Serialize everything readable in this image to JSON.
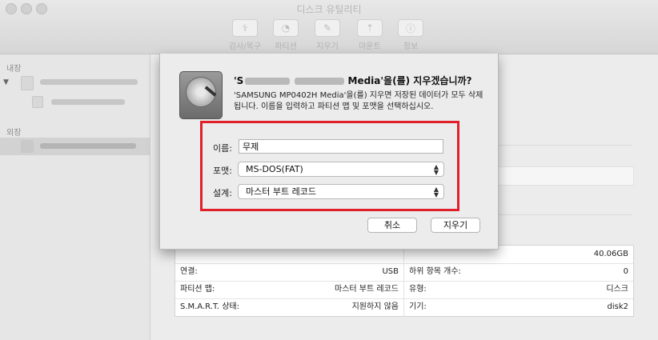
{
  "window": {
    "title": "디스크 유틸리티"
  },
  "toolbar": {
    "items": [
      {
        "label": "검사/복구",
        "icon": "stethoscope-icon"
      },
      {
        "label": "파티션",
        "icon": "pie-chart-icon"
      },
      {
        "label": "지우기",
        "icon": "eraser-icon"
      },
      {
        "label": "마운트",
        "icon": "mount-icon"
      },
      {
        "label": "정보",
        "icon": "info-icon"
      }
    ]
  },
  "sidebar": {
    "internal_label": "내장",
    "external_label": "외장"
  },
  "info": {
    "top_right_value": "40.06GB",
    "left": [
      {
        "key": "연결:",
        "value": "USB"
      },
      {
        "key": "파티션 맵:",
        "value": "마스터 부트 레코드"
      },
      {
        "key": "S.M.A.R.T. 상태:",
        "value": "지원하지 않음"
      }
    ],
    "right": [
      {
        "key": "하위 항목 개수:",
        "value": "0"
      },
      {
        "key": "유형:",
        "value": "디스크"
      },
      {
        "key": "기기:",
        "value": "disk2"
      }
    ]
  },
  "dialog": {
    "title_prefix": "'S",
    "title_suffix": " Media'을(를) 지우겠습니까?",
    "message": "'SAMSUNG MP0402H Media'을(를) 지우면 저장된 데이터가 모두 삭제됩니다. 이름을 입력하고 파티션 맵 및 포맷을 선택하십시오.",
    "name_label": "이름:",
    "name_value": "무제",
    "format_label": "포맷:",
    "format_value": "MS-DOS(FAT)",
    "scheme_label": "설계:",
    "scheme_value": "마스터 부트 레코드",
    "cancel_label": "취소",
    "erase_label": "지우기"
  },
  "colors": {
    "highlight": "#e0212b"
  }
}
